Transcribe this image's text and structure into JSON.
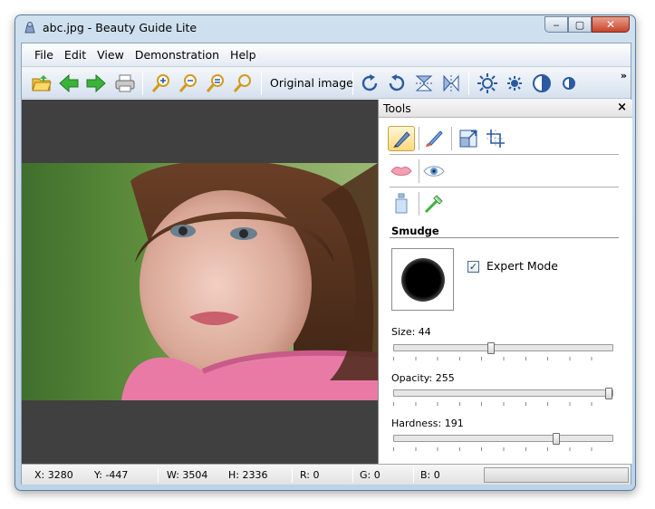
{
  "window": {
    "title": "abc.jpg - Beauty Guide Lite",
    "controls": {
      "minimize": "‒",
      "maximize": "▢",
      "close": "✕"
    }
  },
  "menu": [
    "File",
    "Edit",
    "View",
    "Demonstration",
    "Help"
  ],
  "toolbar": {
    "buttons": [
      "open-folder-icon",
      "back-arrow-icon",
      "forward-arrow-icon",
      "print-icon",
      "zoom-in-icon",
      "zoom-out-icon",
      "zoom-fit-icon",
      "zoom-actual-icon",
      "rotate-right-icon",
      "rotate-left-icon",
      "flip-vertical-icon",
      "flip-horizontal-icon",
      "brightness-up-icon",
      "brightness-down-icon",
      "contrast-up-icon",
      "contrast-down-icon"
    ],
    "original_image_label": "Original image",
    "overflow": "»"
  },
  "tools_panel": {
    "title": "Tools",
    "close": "×",
    "section_title": "Smudge",
    "expert_mode_label": "Expert Mode",
    "expert_mode_checked": true,
    "check_mark": "✓",
    "sliders": [
      {
        "label": "Size: 44",
        "value": 44,
        "max": 100
      },
      {
        "label": "Opacity: 255",
        "value": 255,
        "max": 255
      },
      {
        "label": "Hardness: 191",
        "value": 191,
        "max": 255
      }
    ]
  },
  "status": {
    "x": "X: 3280",
    "y": "Y: -447",
    "w": "W: 3504",
    "h": "H: 2336",
    "r": "R: 0",
    "g": "G: 0",
    "b": "B: 0"
  },
  "colors": {
    "canvas_bg": "#404040",
    "panel_bg": "#ffffff",
    "accent_blue": "#3a6ea5",
    "arrow_green": "#3bb33b"
  }
}
